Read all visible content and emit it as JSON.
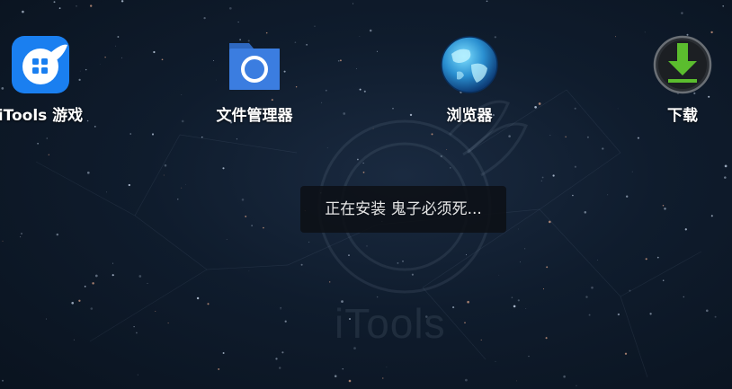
{
  "apps": [
    {
      "label": "iTools 游戏",
      "icon": "itools-games-icon"
    },
    {
      "label": "文件管理器",
      "icon": "folder-icon"
    },
    {
      "label": "浏览器",
      "icon": "globe-icon"
    },
    {
      "label": "下载",
      "icon": "download-arrow-icon"
    }
  ],
  "toast": {
    "message": "正在安装 鬼子必须死..."
  },
  "wallpaper": {
    "watermark": "iTools"
  },
  "colors": {
    "itools_blue": "#1a7ff0",
    "folder_blue": "#3b7de0",
    "download_green": "#5bbd2e",
    "background": "#0f1c2d"
  }
}
